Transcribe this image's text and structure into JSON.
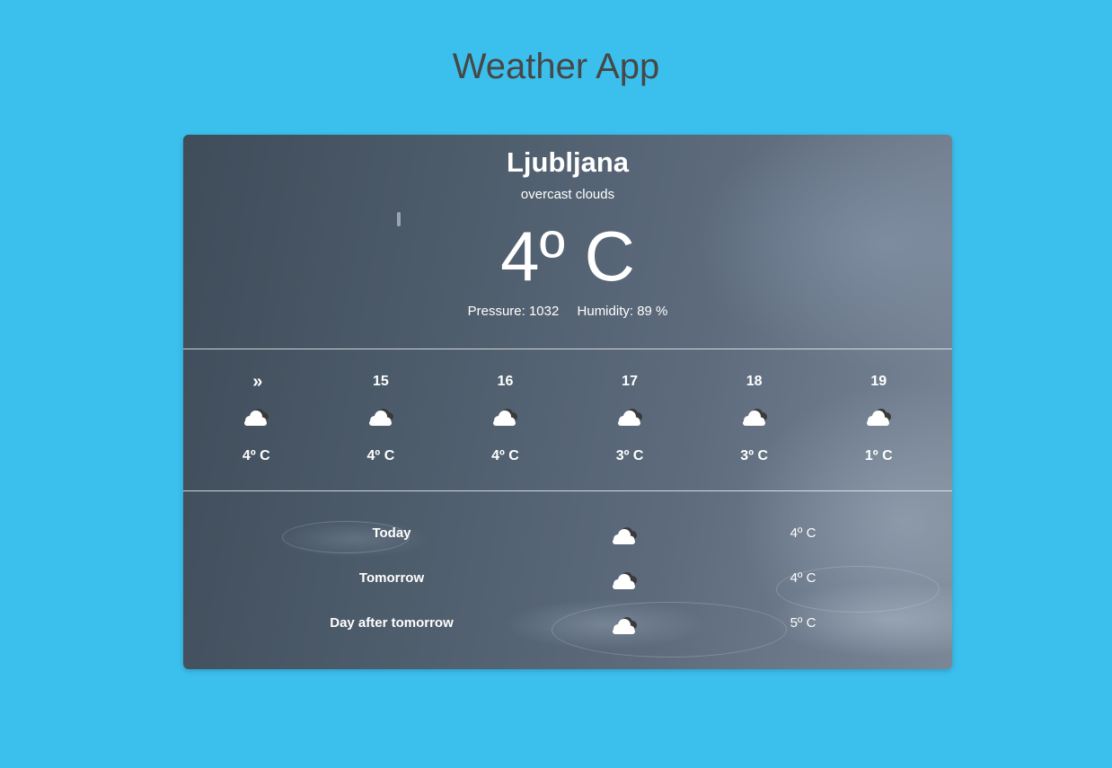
{
  "app": {
    "title": "Weather App"
  },
  "current": {
    "city": "Ljubljana",
    "description": "overcast clouds",
    "temperature": "4º C",
    "pressure": "Pressure: 1032",
    "humidity": "Humidity: 89 %"
  },
  "hourly": [
    {
      "label": "»",
      "icon": "overcast-clouds-icon",
      "temp": "4º C"
    },
    {
      "label": "15",
      "icon": "overcast-clouds-icon",
      "temp": "4º C"
    },
    {
      "label": "16",
      "icon": "overcast-clouds-icon",
      "temp": "4º C"
    },
    {
      "label": "17",
      "icon": "overcast-clouds-icon",
      "temp": "3º C"
    },
    {
      "label": "18",
      "icon": "overcast-clouds-icon",
      "temp": "3º C"
    },
    {
      "label": "19",
      "icon": "overcast-clouds-icon",
      "temp": "1º C"
    }
  ],
  "daily": [
    {
      "day": "Today",
      "icon": "overcast-clouds-icon",
      "temp": "4º C"
    },
    {
      "day": "Tomorrow",
      "icon": "overcast-clouds-icon",
      "temp": "4º C"
    },
    {
      "day": "Day after tomorrow",
      "icon": "overcast-clouds-icon",
      "temp": "5º C"
    }
  ],
  "colors": {
    "page_background": "#3bbfec",
    "title_text": "#474747",
    "card_text": "#ffffff"
  }
}
